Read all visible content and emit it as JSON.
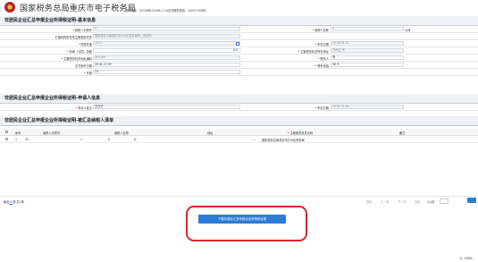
{
  "header": {
    "title": "国家税务总局重庆市电子税务局",
    "hotline": "咨询热线：023-88812366-1 CA证书服务热线：4000235888"
  },
  "section_basic": {
    "title": "非居民企业汇总申报企业所得税证明-基本信息",
    "taxpayer_id_label": "纳税人识别号",
    "taxpayer_id_value": "5",
    "taxpayer_name_label": "纳税人名称",
    "taxpayer_name_value": "5",
    "taxpayer_name_suffix": "公司",
    "tax_office_label": "汇缴机构所在地主管税务机关",
    "tax_office_value": "国家税务总局重庆市万州区税务局第二税务所",
    "year_label": "所属年度",
    "year_value": "2017",
    "date_label": "申请日期",
    "date_value": "2018-09-15",
    "profit_label": "利润（亏损）总额",
    "profit_value": "0.0",
    "mgr_addr_label": "主管税务机关所在地址",
    "mgr_addr_value": "万州区 号",
    "main_org_label": "主要税务机关地址编码",
    "main_org_value": "464100",
    "contact_label": "联系人",
    "contact_value": "李",
    "doc_date_label": "文书制作日期",
    "doc_date_value": "2018-11-09",
    "phone_label": "联系电话",
    "phone_value": "58 5",
    "period_label": "年限",
    "period_value": "23"
  },
  "section_applicant": {
    "title": "非居民企业汇总申报企业所得税证明-申请人信息",
    "applicant_label": "申请人姓名",
    "applicant_value": "王在天",
    "apply_date_label": "申请日期",
    "apply_date_value": "2018-11-09"
  },
  "section_list": {
    "title": "非居民企业汇总申报企业所得税证明-被汇总纳税人清单",
    "columns": [
      "序号",
      "纳税人识别号",
      "纳税人名称",
      "地址",
      "主管税务机关名称",
      "备注"
    ],
    "rows": [
      {
        "no": "1",
        "id": "51",
        "id_tail": "1",
        "name": "0",
        "name_tail": "",
        "name_mid": "D",
        "addr": "",
        "addr_tail": "...",
        "office": "国家税务总局重庆市万州区税务局",
        "note": ""
      }
    ]
  },
  "pager": {
    "per_page_prefix": "每页",
    "per_page": "20",
    "per_page_suffix": "条 共1条",
    "first": "首页",
    "prev": "上一页",
    "next": "下一页",
    "last": "末页",
    "page_info": "1/1页"
  },
  "actions": {
    "submit_label": "下载非居民汇总申报企业所得税证明"
  },
  "status": {
    "zoom": "100%"
  },
  "colors": {
    "accent": "#2e7bd6",
    "highlight": "#d8262d"
  }
}
